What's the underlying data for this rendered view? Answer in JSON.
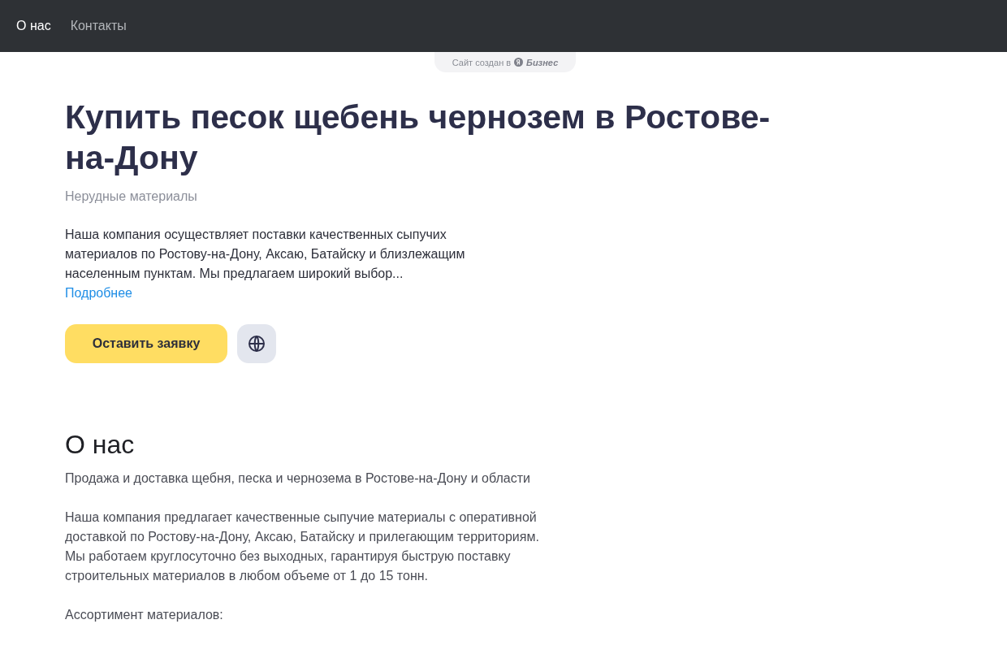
{
  "nav": {
    "items": [
      {
        "label": "О нас",
        "selected": true
      },
      {
        "label": "Контакты",
        "selected": false
      }
    ]
  },
  "badge": {
    "text": "Сайт создан в",
    "brand": "Бизнес"
  },
  "hero": {
    "title": "Купить песок щебень чернозем в Ростове-на-Дону",
    "subtitle": "Нерудные материалы",
    "description": "Наша компания осуществляет поставки качественных сыпучих материалов по Ростову-на-Дону, Аксаю, Батайску и близлежащим населенным пунктам. Мы предлагаем широкий выбор...",
    "more_link": "Подробнее",
    "primary_button": "Оставить заявку"
  },
  "about": {
    "heading": "О нас",
    "paragraphs": [
      "Продажа и доставка щебня, песка и чернозема в Ростове-на-Дону и области",
      "Наша компания предлагает качественные сыпучие материалы с оперативной доставкой по Ростову-на-Дону, Аксаю, Батайску и прилегающим территориям. Мы работаем круглосуточно без выходных, гарантируя быструю поставку строительных материалов в любом объеме от 1 до 15 тонн.",
      "Ассортимент материалов:"
    ]
  }
}
